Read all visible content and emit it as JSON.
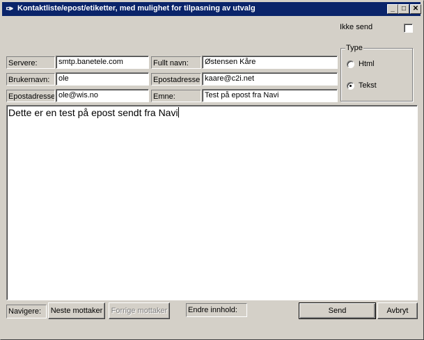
{
  "window": {
    "title": "Kontaktliste/epost/etiketter, med mulighet for tilpasning av utvalg",
    "app_icon": "compass-icon"
  },
  "options": {
    "ikke_send_label": "Ikke send",
    "ikke_send_checked": false
  },
  "type_group": {
    "title": "Type",
    "options": [
      {
        "label": "Html",
        "selected": false
      },
      {
        "label": "Tekst",
        "selected": true
      }
    ]
  },
  "server": {
    "servere_label": "Servere:",
    "servere_value": "smtp.banetele.com",
    "brukernavn_label": "Brukernavn:",
    "brukernavn_value": "ole",
    "epostadresse_label": "Epostadresse:",
    "epostadresse_value": "ole@wis.no"
  },
  "recipient": {
    "fullt_navn_label": "Fullt navn:",
    "fullt_navn_value": "Østensen Kåre",
    "epostadresse_label": "Epostadresse:",
    "epostadresse_value": "kaare@c2i.net",
    "emne_label": "Emne:",
    "emne_value": "Test på epost fra Navi"
  },
  "body_text": "Dette er en test på epost sendt fra Navi",
  "footer": {
    "navigere_label": "Navigere:",
    "neste_label": "Neste mottaker",
    "forrige_label": "Forrige mottaker",
    "endre_label": "Endre innhold:",
    "send_label": "Send",
    "avbryt_label": "Avbryt"
  }
}
